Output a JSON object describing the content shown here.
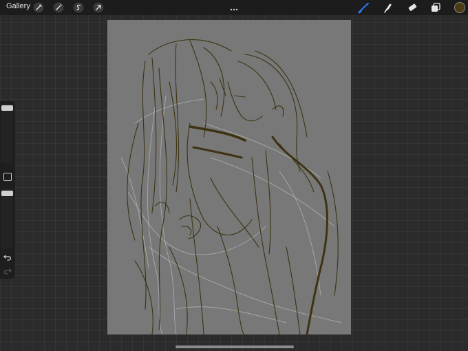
{
  "topbar": {
    "gallery_label": "Gallery",
    "left_tools": [
      "wrench-icon",
      "magic-wand-icon",
      "selection-icon",
      "transform-arrow-icon"
    ],
    "right_tools": [
      "brush-icon",
      "smudge-icon",
      "eraser-icon",
      "layers-icon"
    ],
    "active_tool": "brush-icon",
    "current_color": "#4a3b12"
  },
  "colors": {
    "topbar": "#1c1c1c",
    "canvas_background": "#777877",
    "sketch_dark": "#3d3312",
    "sketch_light": "#b9bcbc",
    "active_blue": "#2f7bff"
  },
  "sidebar": {
    "brush_size_level": 0.0,
    "opacity_level": 0.0,
    "buttons": [
      "modify-square-icon",
      "undo-icon",
      "redo-icon"
    ]
  }
}
